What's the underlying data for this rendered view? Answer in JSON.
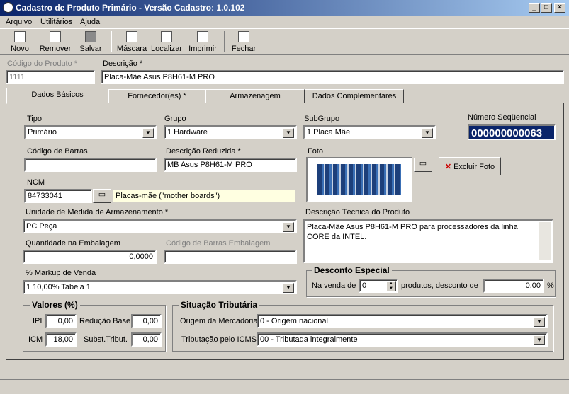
{
  "window": {
    "title": "Cadastro de Produto Primário - Versão Cadastro: 1.0.102",
    "minimize": "_",
    "maximize": "□",
    "close": "×"
  },
  "menu": [
    "Arquivo",
    "Utilitários",
    "Ajuda"
  ],
  "toolbar": {
    "novo": "Novo",
    "remover": "Remover",
    "salvar": "Salvar",
    "mascara": "Máscara",
    "localizar": "Localizar",
    "imprimir": "Imprimir",
    "fechar": "Fechar"
  },
  "header": {
    "codigo_label": "Código do Produto *",
    "codigo_value": "1111",
    "descricao_label": "Descrição *",
    "descricao_value": "Placa-Mãe Asus P8H61-M PRO"
  },
  "tabs": [
    "Dados Básicos",
    "Fornecedor(es) *",
    "Armazenagem",
    "Dados Complementares"
  ],
  "form": {
    "tipo_label": "Tipo",
    "tipo_value": "Primário",
    "grupo_label": "Grupo",
    "grupo_value": "1 Hardware",
    "subgrupo_label": "SubGrupo",
    "subgrupo_value": "1 Placa Mãe",
    "seq_label": "Número Seqüencial",
    "seq_value": "000000000063",
    "codbarras_label": "Código de Barras",
    "codbarras_value": "",
    "descred_label": "Descrição Reduzida *",
    "descred_value": "MB Asus P8H61-M PRO",
    "foto_label": "Foto",
    "excluir_foto": "Excluir Foto",
    "ncm_label": "NCM",
    "ncm_value": "84733041",
    "ncm_desc": "Placas-mãe (\"mother boards\")",
    "unidade_label": "Unidade de Medida de Armazenamento *",
    "unidade_value": "PC Peça",
    "desctec_label": "Descrição Técnica do Produto",
    "desctec_value": "Placa-Mãe Asus P8H61-M PRO para processadores da linha CORE da INTEL.",
    "qtd_label": "Quantidade na Embalagem",
    "qtd_value": "0,0000",
    "codbarras_emb_label": "Código de Barras Embalagem",
    "codbarras_emb_value": "",
    "markup_label": "% Markup de Venda",
    "markup_value": "1 10,00% Tabela 1"
  },
  "desconto": {
    "title": "Desconto Especial",
    "na_venda": "Na venda de",
    "qtd": "0",
    "produtos": "produtos, desconto de",
    "valor": "0,00",
    "pct": "%"
  },
  "valores": {
    "title": "Valores (%)",
    "ipi_label": "IPI",
    "ipi": "0,00",
    "red_label": "Redução Base",
    "red": "0,00",
    "icm_label": "ICM",
    "icm": "18,00",
    "subst_label": "Subst.Tribut.",
    "subst": "0,00"
  },
  "situacao": {
    "title": "Situação Tributária",
    "origem_label": "Origem da Mercadoria",
    "origem_value": "0 - Origem nacional",
    "trib_label": "Tributação pelo ICMS",
    "trib_value": "00 - Tributada integralmente"
  }
}
